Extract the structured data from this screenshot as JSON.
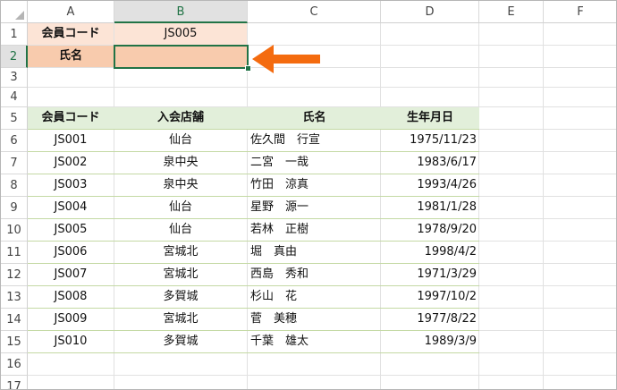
{
  "columns": [
    "A",
    "B",
    "C",
    "D",
    "E",
    "F"
  ],
  "rows": [
    "1",
    "2",
    "3",
    "4",
    "5",
    "6",
    "7",
    "8",
    "9",
    "10",
    "11",
    "12",
    "13",
    "14",
    "15",
    "16",
    "17"
  ],
  "active_column": "B",
  "active_row": "2",
  "form": {
    "member_code_label": "会員コード",
    "member_code_value": "JS005",
    "name_label": "氏名",
    "name_value": ""
  },
  "table": {
    "headers": [
      "会員コード",
      "入会店舗",
      "氏名",
      "生年月日"
    ],
    "rows": [
      [
        "JS001",
        "仙台",
        "佐久間　行宣",
        "1975/11/23"
      ],
      [
        "JS002",
        "泉中央",
        "二宮　一哉",
        "1983/6/17"
      ],
      [
        "JS003",
        "泉中央",
        "竹田　涼真",
        "1993/4/26"
      ],
      [
        "JS004",
        "仙台",
        "星野　源一",
        "1981/1/28"
      ],
      [
        "JS005",
        "仙台",
        "若林　正樹",
        "1978/9/20"
      ],
      [
        "JS006",
        "宮城北",
        "堀　真由",
        "1998/4/2"
      ],
      [
        "JS007",
        "宮城北",
        "西島　秀和",
        "1971/3/29"
      ],
      [
        "JS008",
        "多賀城",
        "杉山　花",
        "1997/10/2"
      ],
      [
        "JS009",
        "宮城北",
        "菅　美穂",
        "1977/8/22"
      ],
      [
        "JS010",
        "多賀城",
        "千葉　雄太",
        "1989/3/9"
      ]
    ]
  },
  "colors": {
    "header_fill": "#e2efda",
    "label_fill_a1": "#fce4d6",
    "label_fill_a2": "#f8cbad",
    "selected_border": "#217346",
    "arrow": "#f46b0f"
  },
  "icons": {
    "arrow": "left-arrow-icon"
  }
}
